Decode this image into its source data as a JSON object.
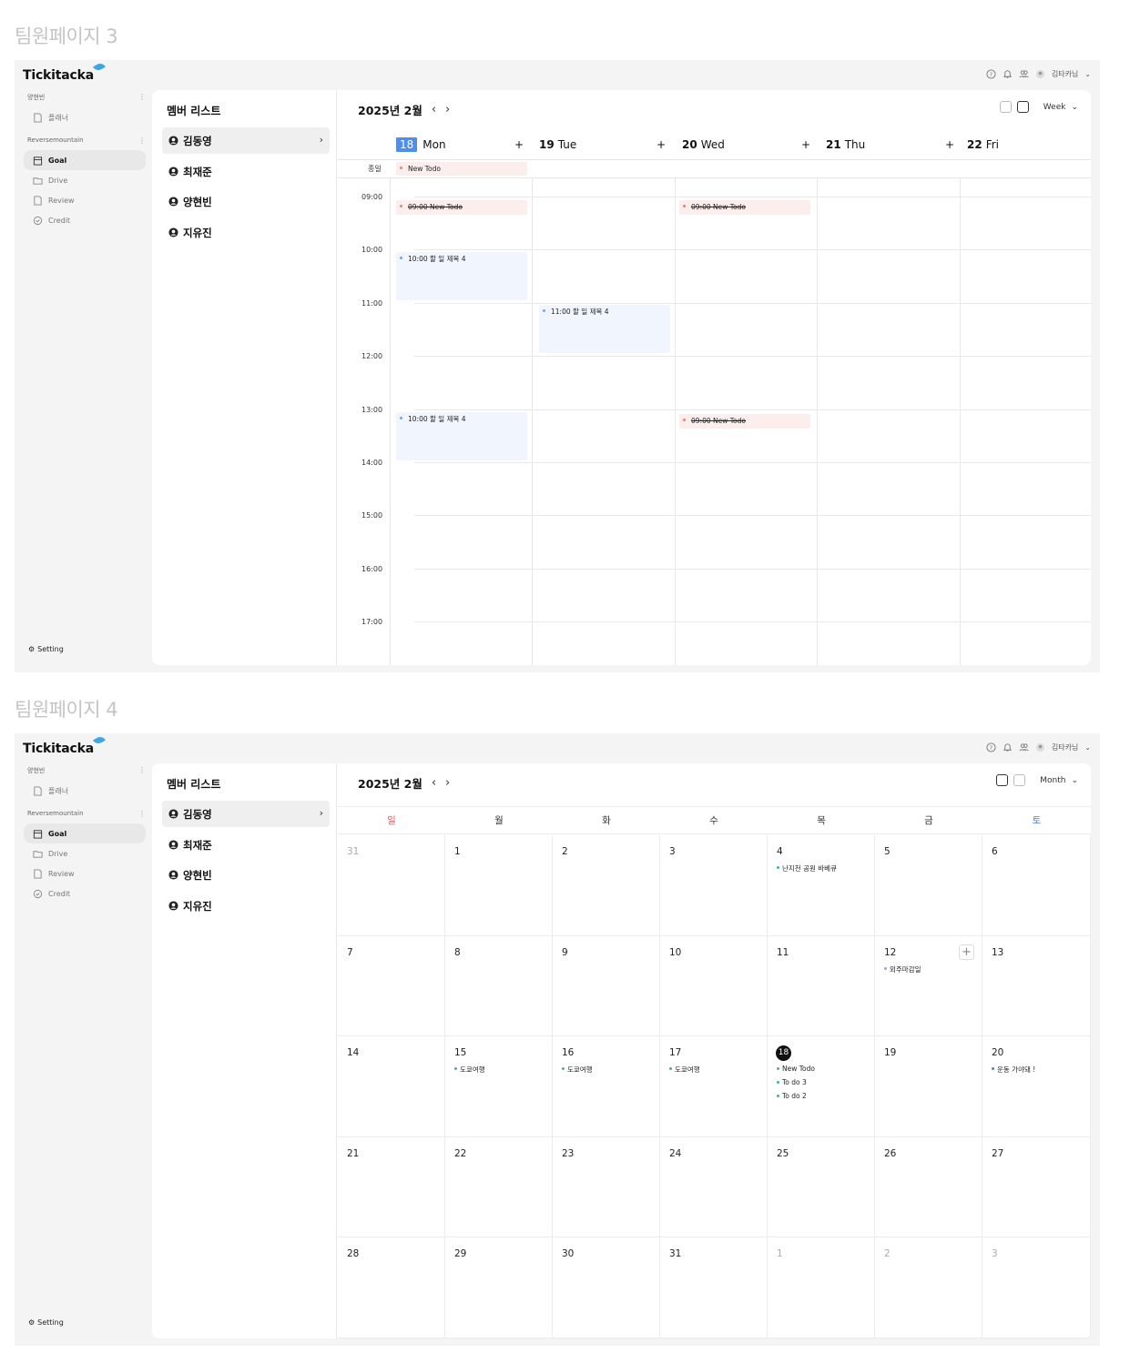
{
  "page3": {
    "label": "팀원페이지 3",
    "app": {
      "logo": "Tickitacka",
      "user": "김타카님"
    },
    "sidebar": {
      "section1": "양현빈",
      "item_planner": "플래너",
      "section2": "Reversemountain",
      "items": [
        "Goal",
        "Drive",
        "Review",
        "Credit"
      ],
      "setting": "Setting"
    },
    "members": {
      "title": "멤버 리스트",
      "list": [
        "김동영",
        "최재준",
        "양현빈",
        "지유진"
      ]
    },
    "calendar": {
      "title": "2025년 2월",
      "view": "Week",
      "days": [
        {
          "num": "18",
          "name": "Mon"
        },
        {
          "num": "19",
          "name": "Tue"
        },
        {
          "num": "20",
          "name": "Wed"
        },
        {
          "num": "21",
          "name": "Thu"
        },
        {
          "num": "22",
          "name": "Fri"
        }
      ],
      "allday_label": "종일",
      "times": [
        "09:00",
        "10:00",
        "11:00",
        "12:00",
        "13:00",
        "14:00",
        "15:00",
        "16:00",
        "17:00"
      ],
      "events": {
        "allday_mon": "New Todo",
        "mon_0900": "09:00 New Todo",
        "wed_0900": "09:00 New Todo",
        "mon_1000": "10:00 할 일 제목 4",
        "tue_1100": "11:00 할 일 제목 4",
        "mon_1300": "10:00 할 일 제목 4",
        "wed_1300": "09:00 New Todo"
      }
    }
  },
  "page4": {
    "label": "팀원페이지 4",
    "app": {
      "logo": "Tickitacka",
      "user": "김타카님"
    },
    "sidebar": {
      "section1": "양현빈",
      "item_planner": "플래너",
      "section2": "Reversemountain",
      "items": [
        "Goal",
        "Drive",
        "Review",
        "Credit"
      ],
      "setting": "Setting"
    },
    "members": {
      "title": "멤버 리스트",
      "list": [
        "김동영",
        "최재준",
        "양현빈",
        "지유진"
      ]
    },
    "calendar": {
      "title": "2025년 2월",
      "view": "Month",
      "weekdays": [
        "일",
        "월",
        "화",
        "수",
        "목",
        "금",
        "토"
      ],
      "weeks": [
        [
          "31",
          "1",
          "2",
          "3",
          "4",
          "5",
          "6"
        ],
        [
          "7",
          "8",
          "9",
          "10",
          "11",
          "12",
          "13"
        ],
        [
          "14",
          "15",
          "16",
          "17",
          "18",
          "19",
          "20"
        ],
        [
          "21",
          "22",
          "23",
          "24",
          "25",
          "26",
          "27"
        ],
        [
          "28",
          "29",
          "30",
          "31",
          "1",
          "2",
          "3"
        ]
      ],
      "events": {
        "feb4": "난지천 공원 바베큐",
        "feb12": "외주마감일",
        "feb15": "도쿄여행",
        "feb16": "도쿄여행",
        "feb17": "도쿄여행",
        "feb18": [
          "New Todo",
          "To do 3",
          "To do 2"
        ],
        "feb20": "운동 가야돼 !"
      }
    }
  }
}
